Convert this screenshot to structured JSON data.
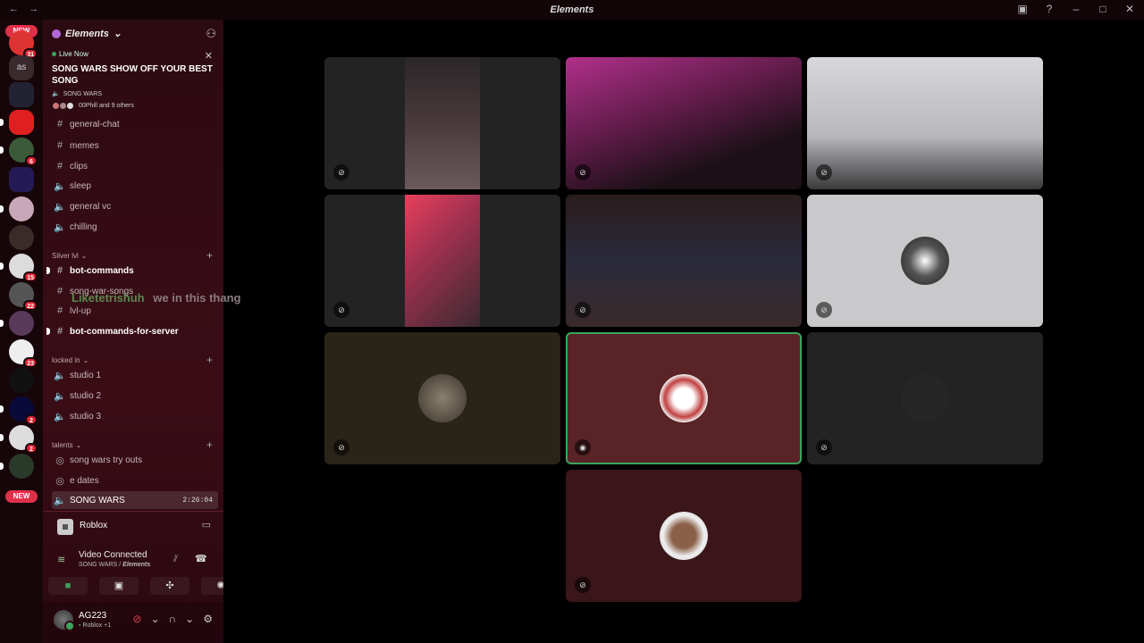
{
  "window": {
    "title": "Elements",
    "back_icon": "back-arrow-icon",
    "forward_icon": "forward-arrow-icon"
  },
  "servers": {
    "new_badge_top": "NEW",
    "new_badge_bottom": "NEW",
    "as_label": "as",
    "badges": [
      "31",
      "6",
      "15",
      "22",
      "23",
      "2",
      "2"
    ]
  },
  "server": {
    "name": "Elements",
    "live": {
      "label": "Live Now",
      "title": "SONG WARS SHOW OFF YOUR BEST SONG",
      "channel": "SONG WARS",
      "users": "00Phill and 9 others"
    },
    "channels_top": [
      {
        "name": "general-chat",
        "icon": "#"
      },
      {
        "name": "memes",
        "icon": "#"
      },
      {
        "name": "clips",
        "icon": "#"
      },
      {
        "name": "sleep",
        "icon": "🔈"
      },
      {
        "name": "general vc",
        "icon": "🔈"
      },
      {
        "name": "chilling",
        "icon": "🔈"
      }
    ],
    "category_silver": "Silver lvl",
    "channels_silver": [
      {
        "name": "bot-commands",
        "icon": "#"
      },
      {
        "name": "song-war-songs",
        "icon": "#"
      },
      {
        "name": "lvl-up",
        "icon": "#"
      },
      {
        "name": "bot-commands-for-server",
        "icon": "#"
      }
    ],
    "category_locked": "locked in",
    "channels_locked": [
      {
        "name": "studio 1",
        "icon": "🔈"
      },
      {
        "name": "studio 2",
        "icon": "🔈"
      },
      {
        "name": "studio 3",
        "icon": "🔈"
      }
    ],
    "category_talents": "talents",
    "channels_talents": [
      {
        "name": "song wars try outs",
        "icon": "◎"
      },
      {
        "name": "e dates",
        "icon": "◎"
      },
      {
        "name": "SONG WARS",
        "icon": "🔈",
        "duration": "2:26:04"
      }
    ]
  },
  "overlay_message": {
    "user": "Liketetrishuh",
    "text": "we in this thang"
  },
  "activity": {
    "name": "Roblox"
  },
  "voice": {
    "status": "Video Connected",
    "channel": "SONG WARS",
    "server": "Elements"
  },
  "user": {
    "name": "AG223",
    "status": "Roblox +1"
  },
  "colors": {
    "accent_green": "#3ba55c",
    "badge_red": "#dd2233",
    "sidebar_bg": "#2c0a12"
  }
}
